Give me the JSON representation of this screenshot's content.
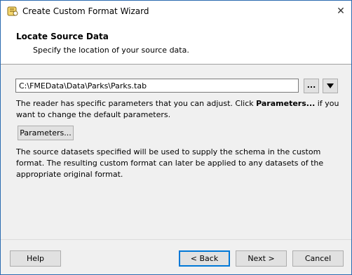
{
  "window": {
    "title": "Create Custom Format Wizard",
    "close_glyph": "✕"
  },
  "header": {
    "title": "Locate Source Data",
    "subtitle": "Specify the location of your source data."
  },
  "source": {
    "path_value": "C:\\FMEData\\Data\\Parks\\Parks.tab",
    "browse_label": "..."
  },
  "reader_info": {
    "text_before": "The reader has specific parameters that you can adjust. Click ",
    "text_bold": "Parameters...",
    "text_after": " if you want to change the default parameters."
  },
  "parameters_button": "Parameters...",
  "schema_info": "The source datasets specified will be used to supply the schema in the custom format. The resulting custom format can later be applied to any datasets of the appropriate original format.",
  "buttons": {
    "help": "Help",
    "back": "< Back",
    "next": "Next >",
    "cancel": "Cancel"
  },
  "icons": {
    "app": "fme-app-icon",
    "close": "close-icon",
    "dropdown": "triangle-down-icon"
  }
}
